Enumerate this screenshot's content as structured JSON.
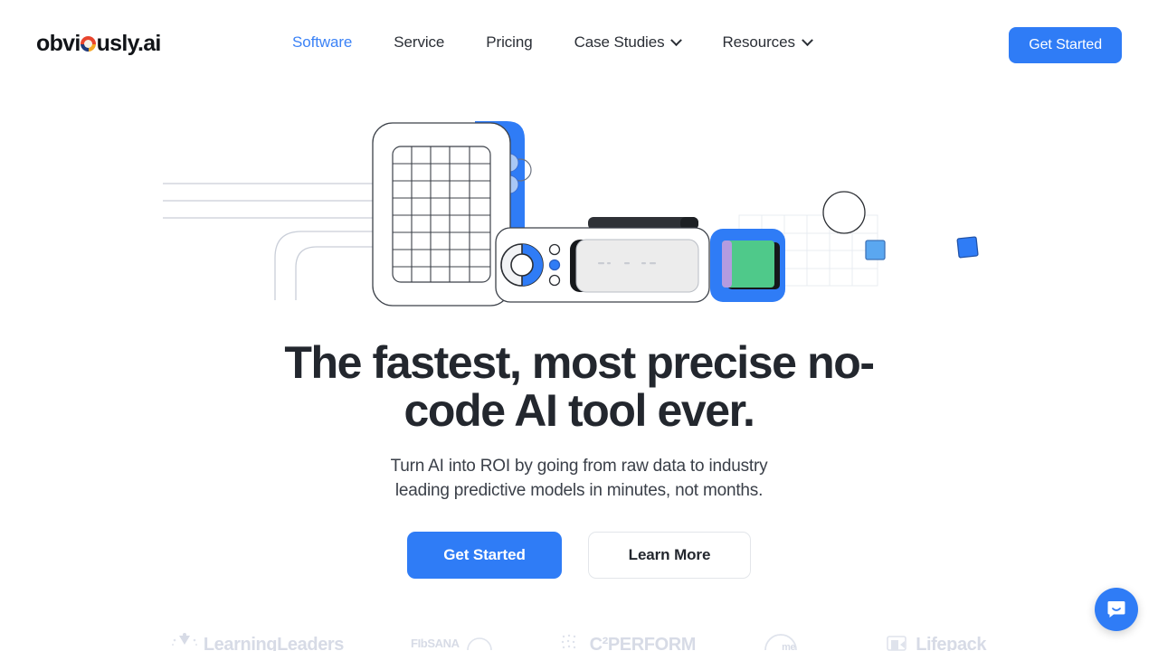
{
  "brand": {
    "name_before": "obvi",
    "name_after": "usly.ai",
    "logo_icon": "pinwheel-circle-icon",
    "accent_color": "#2f7cf6",
    "text_color": "#111418"
  },
  "nav": {
    "items": [
      {
        "label": "Software",
        "active": true,
        "has_dropdown": false
      },
      {
        "label": "Service",
        "active": false,
        "has_dropdown": false
      },
      {
        "label": "Pricing",
        "active": false,
        "has_dropdown": false
      },
      {
        "label": "Case Studies",
        "active": false,
        "has_dropdown": true
      },
      {
        "label": "Resources",
        "active": false,
        "has_dropdown": true
      }
    ],
    "cta_label": "Get Started",
    "dropdown_icon": "chevron-down-icon"
  },
  "hero": {
    "illustration": "no-code-ai-device-illustration",
    "headline_line1": "The fastest, most precise no-",
    "headline_line2": "code AI tool ever.",
    "subhead_line1": "Turn AI into ROI by going from raw data to industry",
    "subhead_line2": "leading predictive models in minutes, not months.",
    "primary_cta": "Get Started",
    "secondary_cta": "Learn More"
  },
  "clients": {
    "items": [
      {
        "name": "LearningLeaders",
        "mark": "starburst-icon"
      },
      {
        "name": "FIbSANA",
        "mark": "arc-icon"
      },
      {
        "name": "C²PERFORM",
        "mark": "dots-icon"
      },
      {
        "name": "me",
        "mark": "arc-icon"
      },
      {
        "name": "Lifepack",
        "mark": "box-icon"
      }
    ]
  },
  "chat": {
    "icon": "intercom-chat-smile-icon",
    "color": "#2f7cf6"
  }
}
